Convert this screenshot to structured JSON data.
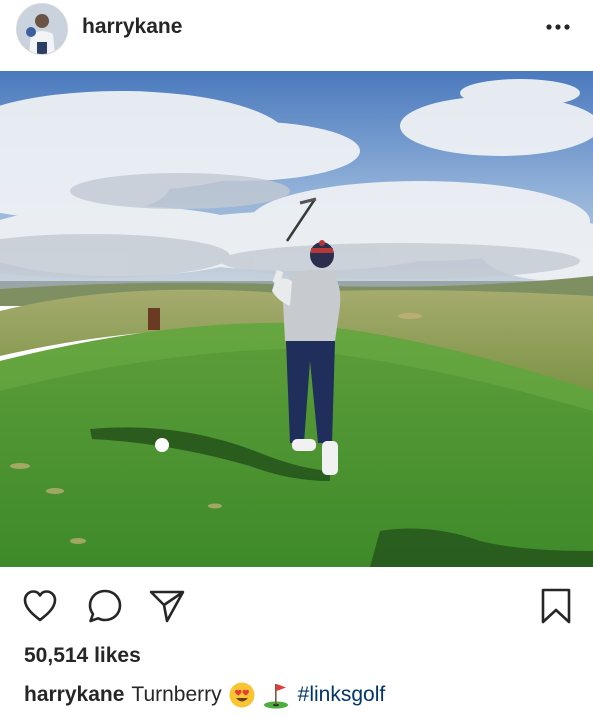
{
  "post": {
    "username": "harrykane",
    "likes": "50,514 likes",
    "caption": {
      "username": "harrykane",
      "text": "Turnberry",
      "emojis": [
        "heart-eyes-emoji",
        "golf-flag-emoji"
      ],
      "hashtag": "#linksgolf"
    }
  },
  "colors": {
    "text": "#262626",
    "hashtag": "#003569",
    "border": "#dbdbdb"
  },
  "icons": {
    "more": "more-dots-icon",
    "like": "heart-icon",
    "comment": "comment-bubble-icon",
    "share": "paper-plane-icon",
    "save": "bookmark-icon"
  }
}
